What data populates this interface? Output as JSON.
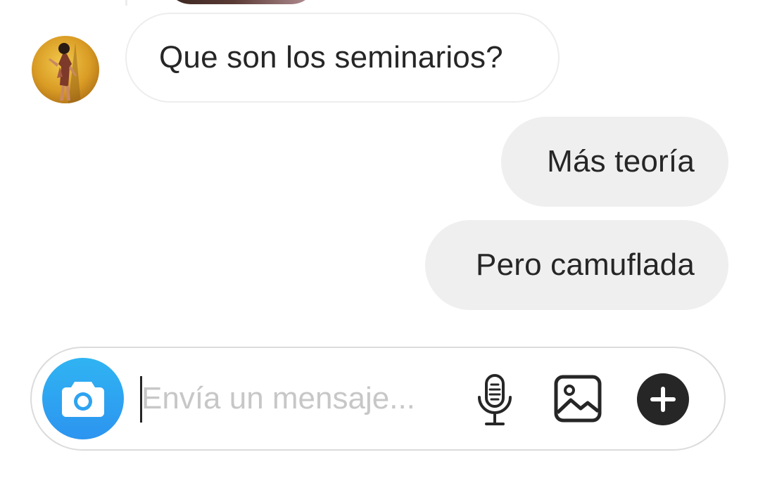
{
  "thread": {
    "incoming": [
      {
        "text": "Que son los seminarios?"
      }
    ],
    "outgoing": [
      {
        "text": "Más teoría"
      },
      {
        "text": "Pero camuflada"
      }
    ]
  },
  "composer": {
    "placeholder": "Envía un mensaje...",
    "value": "",
    "camera_color": "#2EA3F1"
  },
  "icons": {
    "camera": "camera-icon",
    "mic": "microphone-icon",
    "gallery": "image-gallery-icon",
    "plus": "plus-icon"
  }
}
